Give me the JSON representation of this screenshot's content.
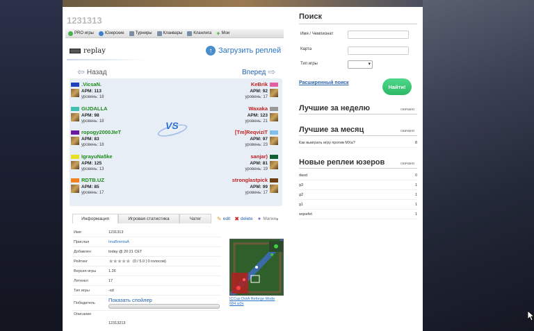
{
  "page_title": "1231313",
  "tabs": [
    {
      "label": "PRO игры",
      "icon": "green-circle-icon"
    },
    {
      "label": "Юзерские",
      "icon": "blue-circle-icon"
    },
    {
      "label": "Турниры",
      "icon": "book-icon"
    },
    {
      "label": "Кланвары",
      "icon": "book-icon"
    },
    {
      "label": "Кланлига",
      "icon": "book-icon"
    },
    {
      "label": "Мои",
      "icon": "plus-icon"
    }
  ],
  "replay_word": "replay",
  "upload_label": "Загрузить реплей",
  "nav": {
    "back": "Назад",
    "forward": "Вперед"
  },
  "vs": "VS",
  "apm_label": "APM:",
  "level_label": "уровень:",
  "left_team": [
    {
      "name": ".VicsaN.",
      "apm": "113",
      "level": "18",
      "color": "#2040c0"
    },
    {
      "name": "GIJDALLA",
      "apm": "98",
      "level": "18",
      "color": "#40c0b0"
    },
    {
      "name": "ropogy2000JIeT",
      "apm": "83",
      "level": "18",
      "color": "#6a1aa0"
    },
    {
      "name": "IgrayuNa5ke",
      "apm": "125",
      "level": "13",
      "color": "#e8e020"
    },
    {
      "name": "RDTB.UZ",
      "apm": "85",
      "level": "17",
      "color": "#f08020"
    }
  ],
  "right_team": [
    {
      "name": "KeBrik",
      "apm": "92",
      "level": "17",
      "color": "#e060a0"
    },
    {
      "name": "Waxaka",
      "apm": "123",
      "level": "21",
      "color": "#999999"
    },
    {
      "name": "[Tm]ReqviziT",
      "apm": "97",
      "level": "23",
      "color": "#80c0e8"
    },
    {
      "name": "sanjar)",
      "apm": "81",
      "level": "19",
      "color": "#106030"
    },
    {
      "name": "stronglastpick",
      "apm": "99",
      "level": "17",
      "color": "#6a4010"
    }
  ],
  "info_tabs": [
    "Информация",
    "Игровая статистика",
    "Чатег"
  ],
  "actions": {
    "edit": "edit",
    "delete": "delete",
    "magic": "Магия"
  },
  "info": {
    "name_key": "Имя",
    "name_val": "1231313",
    "sender_key": "Прислал",
    "sender_val": "ImaBmmiaA",
    "added_key": "Добавлен",
    "added_val": "today @ 20:21 CET",
    "rating_key": "Рейтинг",
    "rating_val": "(0 / 5.0 | 0 голосов)",
    "version_key": "Версия игры",
    "version_val": "1.26",
    "length_key": "Летенкл",
    "length_val": "17",
    "type_key": "Тип игры",
    "type_val": "-sd",
    "winner_key": "Победитель",
    "spoiler_label": "Показать спойлер",
    "desc_key": "Описание",
    "desc_val": "12313213"
  },
  "map_caption": "ICCup DotA Reforge Mode 684.w3x",
  "search": {
    "title": "Поиск",
    "name_label": "Имя / Чемпионат",
    "map_label": "Карта",
    "type_label": "Тип игры",
    "advanced": "Расширенный поиск",
    "find": "Найти!"
  },
  "best_week": {
    "title": "Лучшие за неделю",
    "note": "скачано"
  },
  "best_month": {
    "title": "Лучшие за месяц",
    "note": "скачано",
    "items": [
      {
        "title": "Как выиграть игру против MXa?",
        "count": "8"
      }
    ]
  },
  "user_replays": {
    "title": "Новые реплеи юзеров",
    "note": "скачано",
    "items": [
      {
        "title": "dasd",
        "count": "0"
      },
      {
        "title": "g3",
        "count": "1"
      },
      {
        "title": "g2",
        "count": "1"
      },
      {
        "title": "g1",
        "count": "1"
      },
      {
        "title": "wqsefet",
        "count": "1"
      }
    ]
  }
}
